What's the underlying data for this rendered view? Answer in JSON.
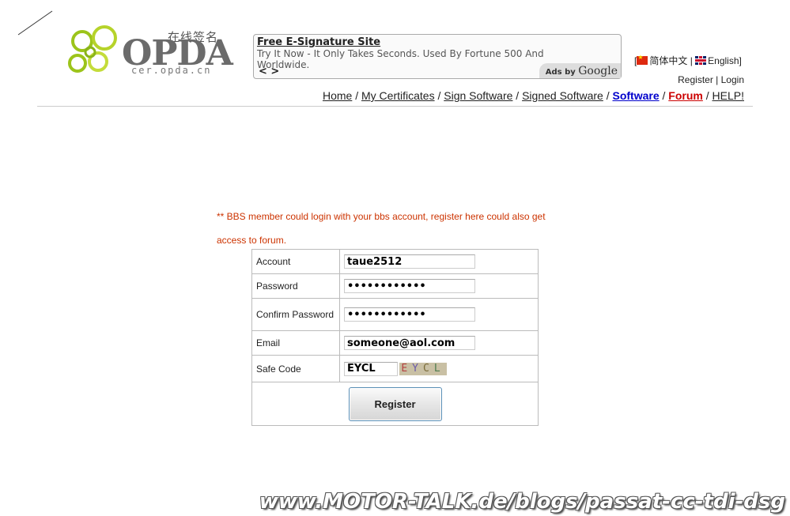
{
  "logo": {
    "cn_text": "在线签名",
    "word": "OPDA",
    "domain": "cer.opda.cn"
  },
  "ad": {
    "title": "Free E-Signature Site",
    "text": "Try It Now - It Only Takes Seconds. Used By Fortune 500 And Worldwide.",
    "nav": "< >",
    "ads_by": "Ads by",
    "google": "Google"
  },
  "lang": {
    "open": "[",
    "chinese": "简体中文",
    "sep": " | ",
    "english": "English",
    "close": "]"
  },
  "auth": {
    "register": "Register",
    "sep": " | ",
    "login": "Login"
  },
  "nav": {
    "items": [
      "Home",
      "My Certificates",
      "Sign Software",
      "Signed Software",
      "Software",
      "Forum",
      "HELP!"
    ],
    "sep": " / "
  },
  "notice": "** BBS member could login with your bbs account, register here could also get access to forum.",
  "form": {
    "account_label": "Account",
    "account_value": "taue2512",
    "password_label": "Password",
    "password_value": "••••••••••••",
    "confirm_label": "Confirm Password",
    "confirm_value": "••••••••••••",
    "email_label": "Email",
    "email_value": "someone@aol.com",
    "safecode_label": "Safe Code",
    "safecode_value": "EYCL",
    "captcha": [
      "E",
      "Y",
      "C",
      "L"
    ],
    "register_button": "Register"
  },
  "watermark": "www.MOTOR-TALK.de/blogs/passat-cc-tdi-dsg"
}
